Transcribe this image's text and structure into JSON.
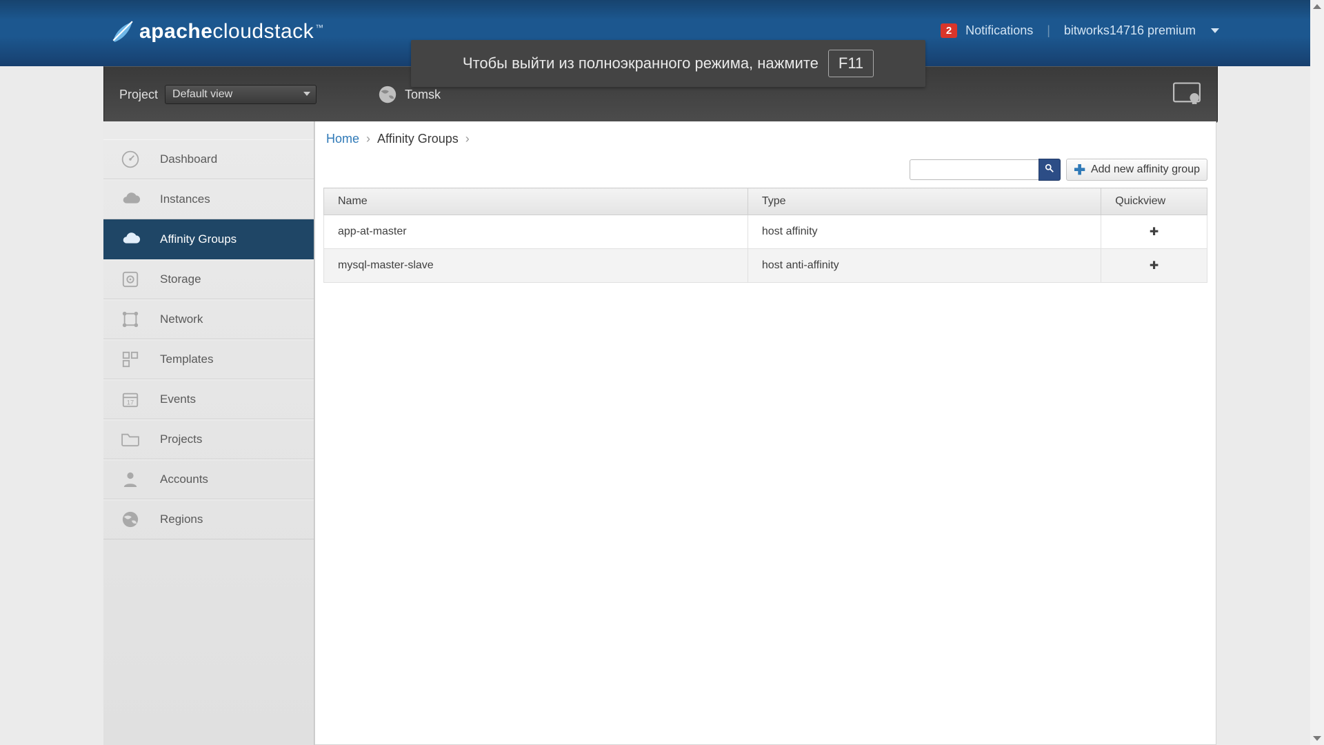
{
  "brand": {
    "prefix": "apache",
    "suffix": "cloudstack"
  },
  "notifications": {
    "count": "2",
    "label": "Notifications"
  },
  "user": "bitworks14716 premium",
  "project": {
    "label": "Project",
    "selected": "Default view"
  },
  "region": "Tomsk",
  "fullscreen_hint": {
    "text": "Чтобы выйти из полноэкранного режима, нажмите",
    "key": "F11"
  },
  "sidebar": {
    "items": [
      {
        "label": "Dashboard",
        "icon": "gauge-icon"
      },
      {
        "label": "Instances",
        "icon": "cloud-icon"
      },
      {
        "label": "Affinity Groups",
        "icon": "cloud-icon",
        "active": true
      },
      {
        "label": "Storage",
        "icon": "disk-icon"
      },
      {
        "label": "Network",
        "icon": "network-icon"
      },
      {
        "label": "Templates",
        "icon": "templates-icon"
      },
      {
        "label": "Events",
        "icon": "calendar-icon"
      },
      {
        "label": "Projects",
        "icon": "folder-icon"
      },
      {
        "label": "Accounts",
        "icon": "person-icon"
      },
      {
        "label": "Regions",
        "icon": "globe-icon"
      }
    ]
  },
  "breadcrumb": {
    "home": "Home",
    "current": "Affinity Groups"
  },
  "actions": {
    "add": "Add new affinity group"
  },
  "table": {
    "columns": {
      "name": "Name",
      "type": "Type",
      "quickview": "Quickview"
    },
    "rows": [
      {
        "name": "app-at-master",
        "type": "host affinity"
      },
      {
        "name": "mysql-master-slave",
        "type": "host anti-affinity"
      }
    ]
  }
}
